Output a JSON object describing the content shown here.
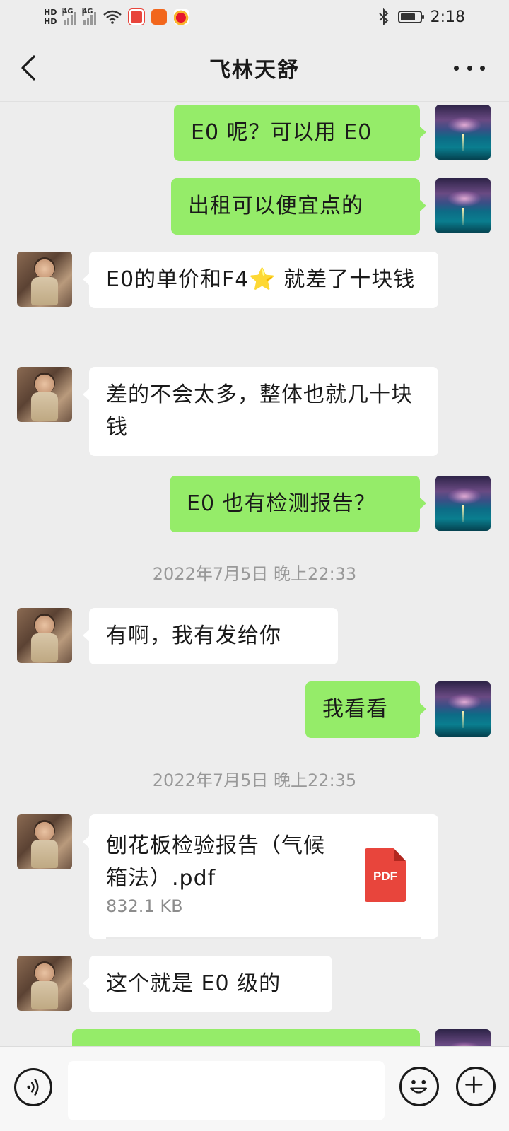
{
  "status_bar": {
    "time": "2:18",
    "hd1": "HD",
    "hd2": "HD",
    "net1": "4G",
    "net2": "4G",
    "icons": [
      "signal-icon",
      "wifi-icon",
      "app-notification-icon",
      "kuaishou-icon",
      "weibo-icon",
      "bluetooth-icon",
      "battery-icon"
    ]
  },
  "header": {
    "title": "飞林天舒"
  },
  "messages": [
    {
      "sender": "me",
      "text": "E0 呢？可以用 E0"
    },
    {
      "sender": "me",
      "text": "出租可以便宜点的"
    },
    {
      "sender": "them",
      "text_before_star": "E0的单价和F4",
      "star": "⭐",
      "text_after_star": " 就差了十块钱"
    },
    {
      "sender": "them",
      "text": "差的不会太多，整体也就几十块钱"
    },
    {
      "sender": "me",
      "text": "E0 也有检测报告？"
    },
    {
      "sender": "them",
      "text": "有啊，我有发给你"
    },
    {
      "sender": "me",
      "text": "我看看"
    },
    {
      "sender": "them",
      "text": "这个就是 E0 级的"
    }
  ],
  "timestamps": [
    "2022年7月5日 晚上22:33",
    "2022年7月5日 晚上22:35"
  ],
  "file": {
    "name": "刨花板检验报告（气候箱法）.pdf",
    "size": "832.1 KB",
    "type_label": "PDF"
  },
  "input": {
    "value": "",
    "placeholder": ""
  },
  "colors": {
    "background": "#ededed",
    "my_bubble": "#95ec69",
    "their_bubble": "#ffffff",
    "pdf_red": "#e8453c",
    "timestamp_text": "#999999"
  }
}
